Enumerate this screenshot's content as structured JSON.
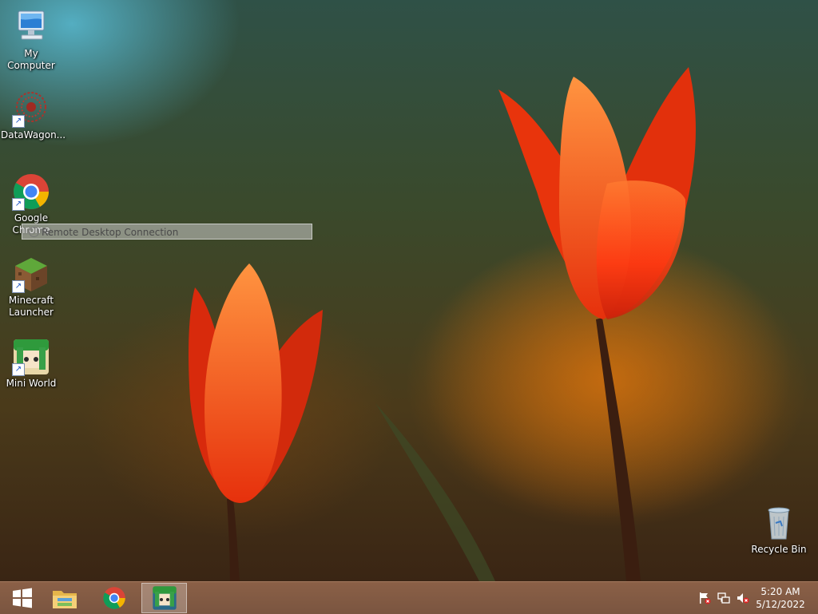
{
  "desktop": {
    "icons": [
      {
        "label": "My Computer",
        "icon": "computer-icon"
      },
      {
        "label": "DataWagon...",
        "icon": "datawagon-icon"
      },
      {
        "label": "Google Chrome",
        "icon": "chrome-icon"
      },
      {
        "label": "Minecraft Launcher",
        "icon": "minecraft-icon"
      },
      {
        "label": "Mini World",
        "icon": "mini-world-icon"
      },
      {
        "label": "Recycle Bin",
        "icon": "recycle-bin-icon"
      }
    ],
    "drag_tooltip": "Remote Desktop Connection"
  },
  "taskbar": {
    "pinned": [
      "windows-logo-icon",
      "file-explorer-icon",
      "chrome-icon",
      "mini-world-icon"
    ],
    "active_app": "Mini World",
    "tray_icons": [
      "action-center-flag-icon",
      "network-icon",
      "volume-muted-icon"
    ],
    "clock": {
      "time": "5:20 AM",
      "date": "5/12/2022"
    }
  },
  "colors": {
    "taskbar": "#7a5540",
    "tulip": "#ff4a14"
  }
}
